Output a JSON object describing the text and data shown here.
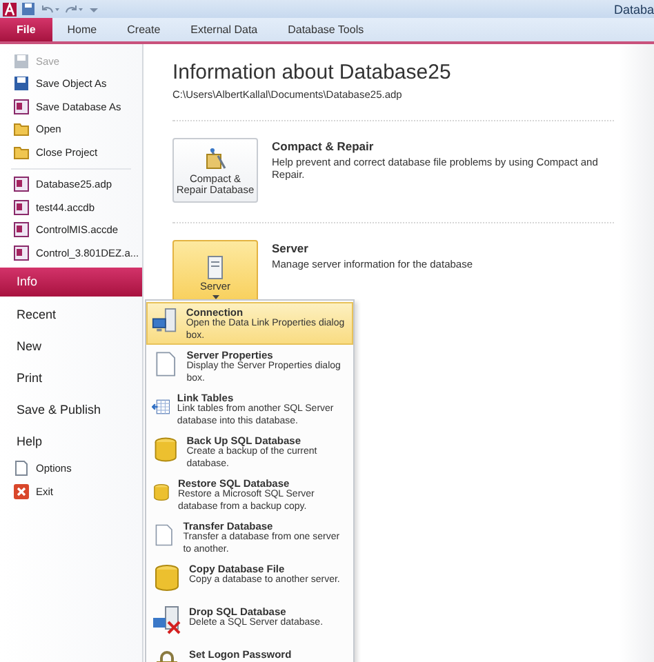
{
  "window": {
    "title": "Databa"
  },
  "ribbon_tabs": [
    {
      "label": "File",
      "selected": true
    },
    {
      "label": "Home",
      "selected": false
    },
    {
      "label": "Create",
      "selected": false
    },
    {
      "label": "External Data",
      "selected": false
    },
    {
      "label": "Database Tools",
      "selected": false
    }
  ],
  "sidebar": {
    "items": [
      {
        "kind": "command",
        "label": "Save",
        "disabled": true,
        "selected": false
      },
      {
        "kind": "command",
        "label": "Save Object As",
        "disabled": false,
        "selected": false
      },
      {
        "kind": "command",
        "label": "Save Database As",
        "disabled": false,
        "selected": false
      },
      {
        "kind": "command",
        "label": "Open",
        "disabled": false,
        "selected": false
      },
      {
        "kind": "command",
        "label": "Close Project",
        "disabled": false,
        "selected": false
      },
      {
        "kind": "file",
        "label": "Database25.adp",
        "disabled": false,
        "selected": false
      },
      {
        "kind": "file",
        "label": "test44.accdb",
        "disabled": false,
        "selected": false
      },
      {
        "kind": "file",
        "label": "ControlMIS.accde",
        "disabled": false,
        "selected": false
      },
      {
        "kind": "file",
        "label": "Control_3.801DEZ.a...",
        "disabled": false,
        "selected": false
      },
      {
        "kind": "section",
        "label": "Info",
        "disabled": false,
        "selected": true
      },
      {
        "kind": "section",
        "label": "Recent",
        "disabled": false,
        "selected": false
      },
      {
        "kind": "section",
        "label": "New",
        "disabled": false,
        "selected": false
      },
      {
        "kind": "section",
        "label": "Print",
        "disabled": false,
        "selected": false
      },
      {
        "kind": "section",
        "label": "Save & Publish",
        "disabled": false,
        "selected": false
      },
      {
        "kind": "section",
        "label": "Help",
        "disabled": false,
        "selected": false
      },
      {
        "kind": "command",
        "label": "Options",
        "disabled": false,
        "selected": false
      },
      {
        "kind": "command",
        "label": "Exit",
        "disabled": false,
        "selected": false
      }
    ]
  },
  "info": {
    "title": "Information about Database25",
    "path": "C:\\Users\\AlbertKallal\\Documents\\Database25.adp",
    "sections": [
      {
        "button": "Compact & Repair Database",
        "heading": "Compact & Repair",
        "description": "Help prevent and correct database file problems by using Compact and Repair.",
        "selected": false,
        "expanded": false
      },
      {
        "button": "Server",
        "heading": "Server",
        "description": "Manage server information for the database",
        "selected": true,
        "expanded": true
      }
    ]
  },
  "server_menu": {
    "items": [
      {
        "title": "Connection",
        "description": "Open the Data Link Properties dialog box.",
        "selected": true
      },
      {
        "title": "Server Properties",
        "description": "Display the Server Properties dialog box.",
        "selected": false
      },
      {
        "title": "Link Tables",
        "description": "Link tables from another SQL Server database into this database.",
        "selected": false
      },
      {
        "title": "Back Up SQL Database",
        "description": "Create a backup of the current database.",
        "selected": false
      },
      {
        "title": "Restore SQL Database",
        "description": "Restore a Microsoft SQL Server database from a backup copy.",
        "selected": false
      },
      {
        "title": "Transfer Database",
        "description": "Transfer a database from one server to another.",
        "selected": false
      },
      {
        "title": "Copy Database File",
        "description": "Copy a database to another server.",
        "selected": false
      },
      {
        "title": "Drop SQL Database",
        "description": "Delete a SQL Server database.",
        "selected": false
      },
      {
        "title": "Set Logon Password",
        "selected": false
      }
    ]
  }
}
